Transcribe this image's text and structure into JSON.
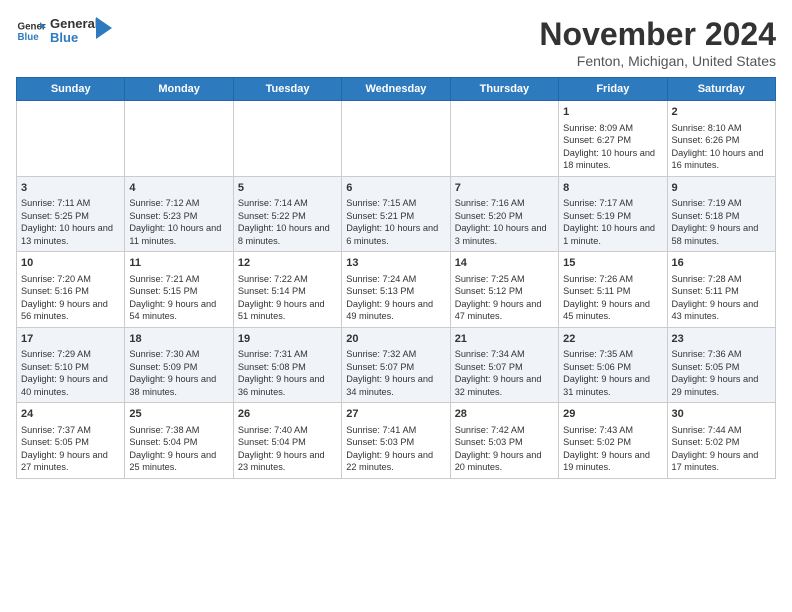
{
  "header": {
    "logo_line1": "General",
    "logo_line2": "Blue",
    "month": "November 2024",
    "location": "Fenton, Michigan, United States"
  },
  "weekdays": [
    "Sunday",
    "Monday",
    "Tuesday",
    "Wednesday",
    "Thursday",
    "Friday",
    "Saturday"
  ],
  "weeks": [
    [
      {
        "day": "",
        "info": ""
      },
      {
        "day": "",
        "info": ""
      },
      {
        "day": "",
        "info": ""
      },
      {
        "day": "",
        "info": ""
      },
      {
        "day": "",
        "info": ""
      },
      {
        "day": "1",
        "info": "Sunrise: 8:09 AM\nSunset: 6:27 PM\nDaylight: 10 hours and 18 minutes."
      },
      {
        "day": "2",
        "info": "Sunrise: 8:10 AM\nSunset: 6:26 PM\nDaylight: 10 hours and 16 minutes."
      }
    ],
    [
      {
        "day": "3",
        "info": "Sunrise: 7:11 AM\nSunset: 5:25 PM\nDaylight: 10 hours and 13 minutes."
      },
      {
        "day": "4",
        "info": "Sunrise: 7:12 AM\nSunset: 5:23 PM\nDaylight: 10 hours and 11 minutes."
      },
      {
        "day": "5",
        "info": "Sunrise: 7:14 AM\nSunset: 5:22 PM\nDaylight: 10 hours and 8 minutes."
      },
      {
        "day": "6",
        "info": "Sunrise: 7:15 AM\nSunset: 5:21 PM\nDaylight: 10 hours and 6 minutes."
      },
      {
        "day": "7",
        "info": "Sunrise: 7:16 AM\nSunset: 5:20 PM\nDaylight: 10 hours and 3 minutes."
      },
      {
        "day": "8",
        "info": "Sunrise: 7:17 AM\nSunset: 5:19 PM\nDaylight: 10 hours and 1 minute."
      },
      {
        "day": "9",
        "info": "Sunrise: 7:19 AM\nSunset: 5:18 PM\nDaylight: 9 hours and 58 minutes."
      }
    ],
    [
      {
        "day": "10",
        "info": "Sunrise: 7:20 AM\nSunset: 5:16 PM\nDaylight: 9 hours and 56 minutes."
      },
      {
        "day": "11",
        "info": "Sunrise: 7:21 AM\nSunset: 5:15 PM\nDaylight: 9 hours and 54 minutes."
      },
      {
        "day": "12",
        "info": "Sunrise: 7:22 AM\nSunset: 5:14 PM\nDaylight: 9 hours and 51 minutes."
      },
      {
        "day": "13",
        "info": "Sunrise: 7:24 AM\nSunset: 5:13 PM\nDaylight: 9 hours and 49 minutes."
      },
      {
        "day": "14",
        "info": "Sunrise: 7:25 AM\nSunset: 5:12 PM\nDaylight: 9 hours and 47 minutes."
      },
      {
        "day": "15",
        "info": "Sunrise: 7:26 AM\nSunset: 5:11 PM\nDaylight: 9 hours and 45 minutes."
      },
      {
        "day": "16",
        "info": "Sunrise: 7:28 AM\nSunset: 5:11 PM\nDaylight: 9 hours and 43 minutes."
      }
    ],
    [
      {
        "day": "17",
        "info": "Sunrise: 7:29 AM\nSunset: 5:10 PM\nDaylight: 9 hours and 40 minutes."
      },
      {
        "day": "18",
        "info": "Sunrise: 7:30 AM\nSunset: 5:09 PM\nDaylight: 9 hours and 38 minutes."
      },
      {
        "day": "19",
        "info": "Sunrise: 7:31 AM\nSunset: 5:08 PM\nDaylight: 9 hours and 36 minutes."
      },
      {
        "day": "20",
        "info": "Sunrise: 7:32 AM\nSunset: 5:07 PM\nDaylight: 9 hours and 34 minutes."
      },
      {
        "day": "21",
        "info": "Sunrise: 7:34 AM\nSunset: 5:07 PM\nDaylight: 9 hours and 32 minutes."
      },
      {
        "day": "22",
        "info": "Sunrise: 7:35 AM\nSunset: 5:06 PM\nDaylight: 9 hours and 31 minutes."
      },
      {
        "day": "23",
        "info": "Sunrise: 7:36 AM\nSunset: 5:05 PM\nDaylight: 9 hours and 29 minutes."
      }
    ],
    [
      {
        "day": "24",
        "info": "Sunrise: 7:37 AM\nSunset: 5:05 PM\nDaylight: 9 hours and 27 minutes."
      },
      {
        "day": "25",
        "info": "Sunrise: 7:38 AM\nSunset: 5:04 PM\nDaylight: 9 hours and 25 minutes."
      },
      {
        "day": "26",
        "info": "Sunrise: 7:40 AM\nSunset: 5:04 PM\nDaylight: 9 hours and 23 minutes."
      },
      {
        "day": "27",
        "info": "Sunrise: 7:41 AM\nSunset: 5:03 PM\nDaylight: 9 hours and 22 minutes."
      },
      {
        "day": "28",
        "info": "Sunrise: 7:42 AM\nSunset: 5:03 PM\nDaylight: 9 hours and 20 minutes."
      },
      {
        "day": "29",
        "info": "Sunrise: 7:43 AM\nSunset: 5:02 PM\nDaylight: 9 hours and 19 minutes."
      },
      {
        "day": "30",
        "info": "Sunrise: 7:44 AM\nSunset: 5:02 PM\nDaylight: 9 hours and 17 minutes."
      }
    ]
  ]
}
